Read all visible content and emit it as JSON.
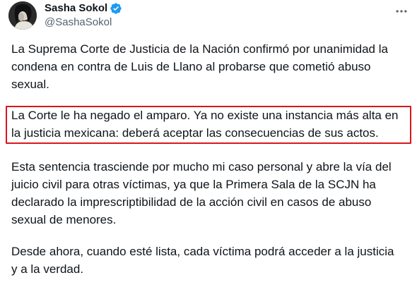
{
  "author": {
    "display_name": "Sasha Sokol",
    "handle": "@SashaSokol",
    "verified": true,
    "verified_color": "#1d9bf0"
  },
  "tweet": {
    "paragraphs": [
      "La Suprema Corte de Justicia de la Nación confirmó por unanimidad la\ncondena en contra de Luis de Llano al probarse que cometió abuso\nsexual.",
      "La Corte le ha negado el amparo. Ya no existe una instancia más alta en\nla justicia mexicana: deberá aceptar las consecuencias de sus actos.",
      "Esta sentencia trasciende por mucho mi caso personal y abre la vía del\njuicio civil para otras víctimas, ya que la Primera Sala de la SCJN ha\ndeclarado la imprescriptibilidad de la acción civil en casos de abuso\nsexual de menores.",
      "Desde ahora, cuando esté lista, cada víctima podrá acceder a la justicia\ny a la verdad."
    ],
    "highlight_color": "#d9161c"
  },
  "icons": {
    "avatar": "avatar-photo",
    "verified": "verified-badge-icon",
    "more": "more-options-icon"
  }
}
